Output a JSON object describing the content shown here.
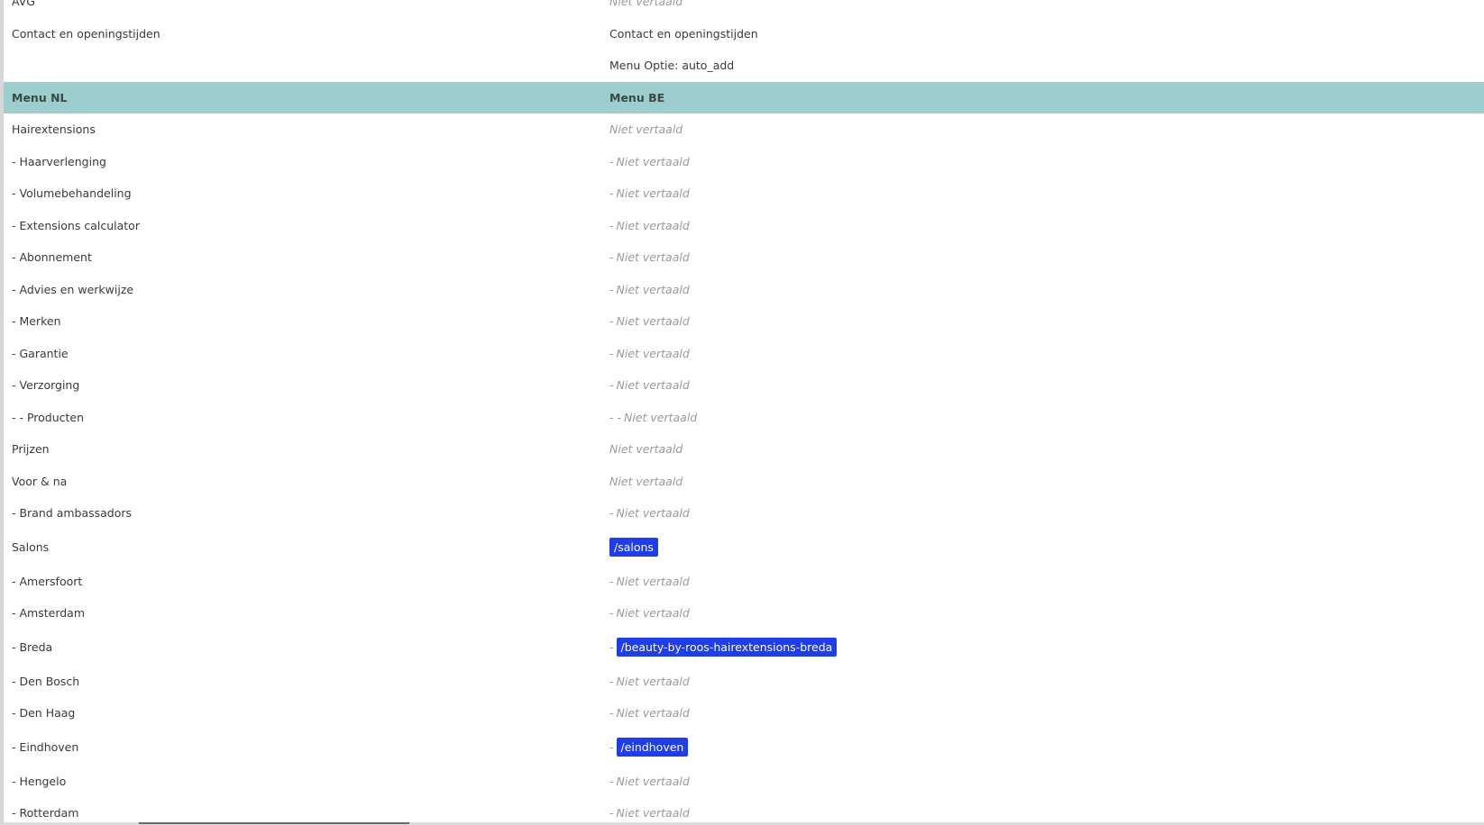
{
  "top_rows": [
    {
      "nl": "AVG",
      "be": "Niet vertaald"
    },
    {
      "nl": "Contact en openingstijden",
      "be": "Contact en openingstijden"
    },
    {
      "nl": "",
      "be": "Menu Optie: auto_add"
    }
  ],
  "header": {
    "nl": "Menu NL",
    "be": "Menu BE"
  },
  "menu_rows": [
    {
      "nl": "Hairextensions",
      "prefix": "",
      "be": "Niet vertaald"
    },
    {
      "nl": "- Haarverlenging",
      "prefix": "-",
      "be": "Niet vertaald"
    },
    {
      "nl": "- Volumebehandeling",
      "prefix": "-",
      "be": "Niet vertaald"
    },
    {
      "nl": "- Extensions calculator",
      "prefix": "-",
      "be": "Niet vertaald"
    },
    {
      "nl": "- Abonnement",
      "prefix": "-",
      "be": "Niet vertaald"
    },
    {
      "nl": "- Advies en werkwijze",
      "prefix": "-",
      "be": "Niet vertaald"
    },
    {
      "nl": "- Merken",
      "prefix": "-",
      "be": "Niet vertaald"
    },
    {
      "nl": "- Garantie",
      "prefix": "-",
      "be": "Niet vertaald"
    },
    {
      "nl": "- Verzorging",
      "prefix": "-",
      "be": "Niet vertaald"
    },
    {
      "nl": "- - Producten",
      "prefix": "- -",
      "be": "Niet vertaald"
    },
    {
      "nl": "Prijzen",
      "prefix": "",
      "be": "Niet vertaald"
    },
    {
      "nl": "Voor & na",
      "prefix": "",
      "be": "Niet vertaald"
    },
    {
      "nl": "- Brand ambassadors",
      "prefix": "-",
      "be": "Niet vertaald"
    },
    {
      "nl": "Salons",
      "prefix": "",
      "slug": "/salons"
    },
    {
      "nl": "- Amersfoort",
      "prefix": "-",
      "be": "Niet vertaald"
    },
    {
      "nl": "- Amsterdam",
      "prefix": "-",
      "be": "Niet vertaald"
    },
    {
      "nl": "- Breda",
      "prefix": "-",
      "slug": "/beauty-by-roos-hairextensions-breda"
    },
    {
      "nl": "- Den Bosch",
      "prefix": "-",
      "be": "Niet vertaald"
    },
    {
      "nl": "- Den Haag",
      "prefix": "-",
      "be": "Niet vertaald"
    },
    {
      "nl": "- Eindhoven",
      "prefix": "-",
      "slug": "/eindhoven"
    },
    {
      "nl": "- Hengelo",
      "prefix": "-",
      "be": "Niet vertaald"
    },
    {
      "nl": "- Rotterdam",
      "prefix": "-",
      "be": "Niet vertaald"
    }
  ],
  "colors": {
    "header_bg": "#9bcecd",
    "slug_badge_bg": "#1f3df0",
    "untranslated_text": "#9a9a9a"
  }
}
